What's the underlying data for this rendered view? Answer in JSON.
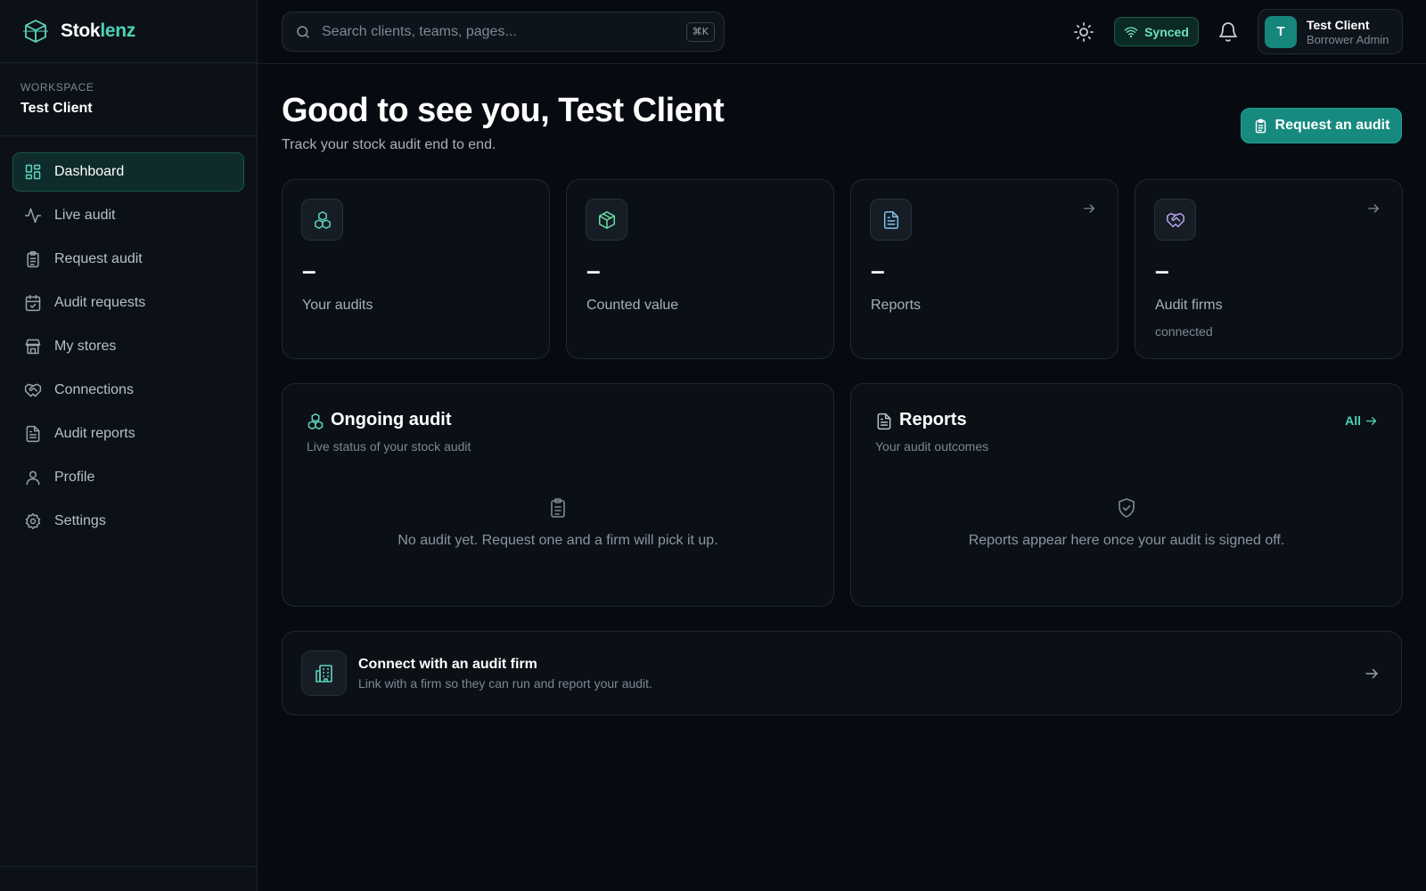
{
  "brand": {
    "name_part1": "Stok",
    "name_part2": "lenz",
    "logo_icon": "cube-logo-icon"
  },
  "workspace": {
    "label": "WORKSPACE",
    "name": "Test Client"
  },
  "sidebar": {
    "items": [
      {
        "label": "Dashboard",
        "icon": "grid-icon",
        "active": true
      },
      {
        "label": "Live audit",
        "icon": "activity-icon"
      },
      {
        "label": "Request audit",
        "icon": "clipboard-icon"
      },
      {
        "label": "Audit requests",
        "icon": "calendar-check-icon"
      },
      {
        "label": "My stores",
        "icon": "store-icon"
      },
      {
        "label": "Connections",
        "icon": "handshake-icon"
      },
      {
        "label": "Audit reports",
        "icon": "file-text-icon"
      },
      {
        "label": "Profile",
        "icon": "user-icon"
      },
      {
        "label": "Settings",
        "icon": "gear-icon"
      }
    ]
  },
  "topbar": {
    "search_placeholder": "Search clients, teams, pages...",
    "search_shortcut": "⌘K",
    "sync_status": "Synced",
    "user": {
      "initial": "T",
      "name": "Test Client",
      "role": "Borrower Admin"
    }
  },
  "main": {
    "greeting": "Good to see you, Test Client",
    "subtitle": "Track your stock audit end to end.",
    "request_button": "Request an audit",
    "stats": [
      {
        "value": "–",
        "label": "Your audits",
        "icon": "boxes-icon"
      },
      {
        "value": "–",
        "label": "Counted value",
        "icon": "package-icon"
      },
      {
        "value": "–",
        "label": "Reports",
        "icon": "file-text-icon"
      },
      {
        "value": "–",
        "label": "Audit firms",
        "note": "connected",
        "icon": "handshake-icon"
      }
    ],
    "ongoing_panel": {
      "title": "Ongoing audit",
      "subtitle": "Live status of your stock audit",
      "empty_text": "No audit yet. Request one and a firm will pick it up."
    },
    "reports_panel": {
      "title": "Reports",
      "subtitle": "Your audit outcomes",
      "link": "All",
      "empty_text": "Reports appear here once your audit is signed off."
    },
    "connect_card": {
      "title": "Connect with an audit firm",
      "subtitle": "Link with a firm so they can run and report your audit."
    }
  },
  "colors": {
    "accent": "#4fd1b8",
    "accent_button": "#178a7f",
    "background": "#070b11",
    "sidebar": "#0b1117",
    "active_item": "#0e2c2b"
  }
}
